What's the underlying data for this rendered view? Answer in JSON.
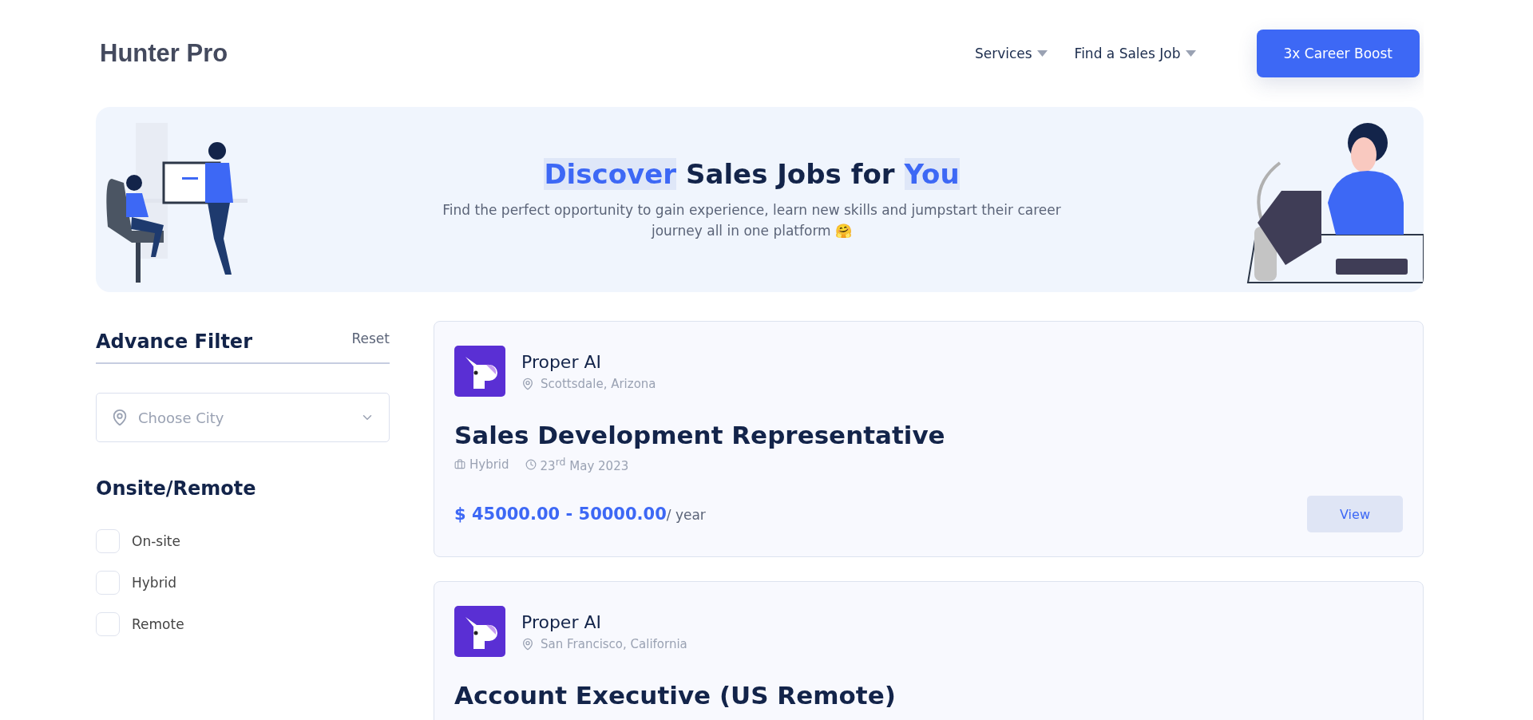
{
  "header": {
    "logo": "Hunter Pro",
    "nav": [
      {
        "label": "Services"
      },
      {
        "label": "Find a Sales Job"
      }
    ],
    "cta": "3x Career Boost"
  },
  "hero": {
    "title_parts": [
      {
        "text": "Discover",
        "highlight": true
      },
      {
        "text": "Sales Jobs for",
        "highlight": false
      },
      {
        "text": "You",
        "highlight": true
      }
    ],
    "subtitle": "Find the perfect opportunity to gain experience, learn new skills and jumpstart their career journey all in one platform 🤗"
  },
  "filter": {
    "title": "Advance Filter",
    "reset": "Reset",
    "city": {
      "placeholder": "Choose City"
    },
    "section": "Onsite/Remote",
    "options": [
      {
        "label": "On-site",
        "checked": false
      },
      {
        "label": "Hybrid",
        "checked": false
      },
      {
        "label": "Remote",
        "checked": false
      }
    ]
  },
  "jobs": [
    {
      "company": "Proper AI",
      "location": "Scottsdale, Arizona",
      "title": "Sales Development Representative",
      "type": "Hybrid",
      "date": "23$^{rd}$ May 2023",
      "salary": "$ 45000.00 - 50000.00",
      "period": "/ year",
      "action": "View"
    },
    {
      "company": "Proper AI",
      "location": "San Francisco, California",
      "title": "Account Executive (US Remote)"
    }
  ]
}
